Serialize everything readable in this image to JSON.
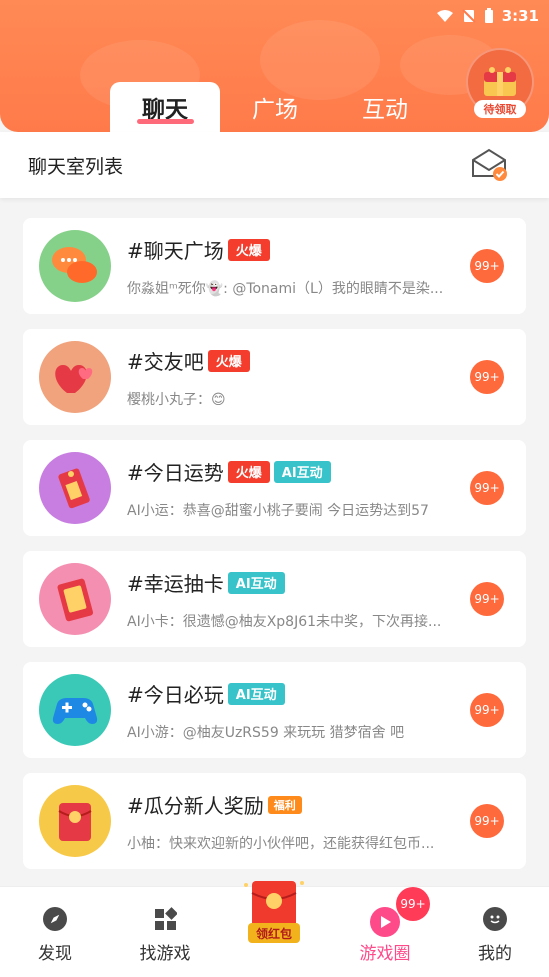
{
  "status": {
    "time": "3:31"
  },
  "header": {
    "tabs": [
      {
        "label": "聊天",
        "active": true
      },
      {
        "label": "广场",
        "active": false
      },
      {
        "label": "互动",
        "active": false
      }
    ],
    "reward_label": "待领取"
  },
  "subheader": {
    "title": "聊天室列表"
  },
  "chatrooms": [
    {
      "title": "#聊天广场",
      "tags": [
        "火爆"
      ],
      "preview": "你淼姐ᵐ死你👻: @Tonami（L）我的眼睛不是染...",
      "badge": "99+",
      "avatar_bg": "#86d18a",
      "icon": "chat-bubbles-icon"
    },
    {
      "title": "#交友吧",
      "tags": [
        "火爆"
      ],
      "preview": "樱桃小丸子：😊",
      "badge": "99+",
      "avatar_bg": "#f0a37c",
      "icon": "hearts-icon"
    },
    {
      "title": "#今日运势",
      "tags": [
        "火爆",
        "AI互动"
      ],
      "preview": "AI小运：恭喜@甜蜜小桃子要闹 今日运势达到57",
      "badge": "99+",
      "avatar_bg": "#c77ee0",
      "icon": "fortune-tag-icon"
    },
    {
      "title": "#幸运抽卡",
      "tags": [
        "AI互动"
      ],
      "preview": "AI小卡：很遗憾@柚友Xp8J61未中奖，下次再接...",
      "badge": "99+",
      "avatar_bg": "#f48fb1",
      "icon": "lucky-card-icon"
    },
    {
      "title": "#今日必玩",
      "tags": [
        "AI互动"
      ],
      "preview": "AI小游：@柚友UzRS59 来玩玩 猎梦宿舍 吧",
      "badge": "99+",
      "avatar_bg": "#39c9b6",
      "icon": "gamepad-icon"
    },
    {
      "title": "#瓜分新人奖励",
      "tags": [
        "福利"
      ],
      "preview": "小柚：快来欢迎新的小伙伴吧，还能获得红包币...",
      "badge": "99+",
      "avatar_bg": "#f7c948",
      "icon": "red-envelope-icon"
    }
  ],
  "bottom_nav": {
    "items": [
      {
        "label": "发现",
        "icon": "compass-icon"
      },
      {
        "label": "找游戏",
        "icon": "apps-icon"
      },
      {
        "label": "领红包",
        "icon": "red-envelope-icon"
      },
      {
        "label": "游戏圈",
        "icon": "play-circle-icon",
        "active": true,
        "badge": "99+"
      },
      {
        "label": "我的",
        "icon": "smile-icon"
      }
    ]
  },
  "colors": {
    "accent": "#ff7a4a",
    "hot_tag": "#f43d2d",
    "ai_tag": "#37c3c9",
    "gift_tag": "#ff8a1c",
    "badge": "#ff6a3d",
    "active_nav": "#ff4a8a"
  }
}
